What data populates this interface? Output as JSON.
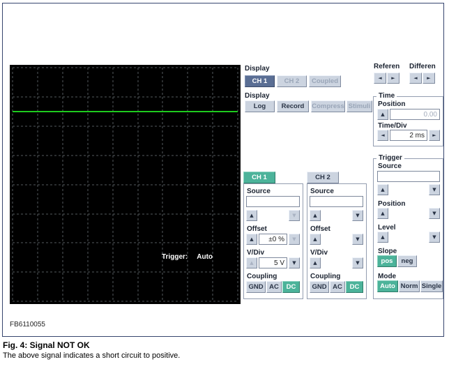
{
  "icons": {
    "up": "▲",
    "down": "▼",
    "left": "◄",
    "right": "►"
  },
  "colors": {
    "accent_teal": "#4cb39a",
    "active_blue": "#5a6e94",
    "scope_trace_green": "#1ecb1e"
  },
  "scope": {
    "trigger_label": "Trigger:",
    "trigger_value": "Auto"
  },
  "display_channels": {
    "label": "Display",
    "ch1": "CH 1",
    "ch2": "CH 2",
    "coupled": "Coupled"
  },
  "display_modes": {
    "label": "Display",
    "log": "Log",
    "record": "Record",
    "compress": "Compress",
    "stimuli": "Stimuli"
  },
  "reference": {
    "label": "Referen"
  },
  "difference": {
    "label": "Differen"
  },
  "time": {
    "label": "Time",
    "position_label": "Position",
    "position_value": "0.00",
    "timediv_label": "Time/Div",
    "timediv_value": "2 ms"
  },
  "trigger": {
    "label": "Trigger",
    "source_label": "Source",
    "position_label": "Position",
    "level_label": "Level",
    "slope_label": "Slope",
    "slope_pos": "pos",
    "slope_neg": "neg",
    "mode_label": "Mode",
    "mode_auto": "Auto",
    "mode_norm": "Norm",
    "mode_single": "Single"
  },
  "ch1": {
    "title": "CH 1",
    "source_label": "Source",
    "offset_label": "Offset",
    "offset_value": "±0 %",
    "vdiv_label": "V/Div",
    "vdiv_value": "5 V",
    "coupling_label": "Coupling",
    "gnd": "GND",
    "ac": "AC",
    "dc": "DC"
  },
  "ch2": {
    "title": "CH 2",
    "source_label": "Source",
    "offset_label": "Offset",
    "vdiv_label": "V/Div",
    "coupling_label": "Coupling",
    "gnd": "GND",
    "ac": "AC",
    "dc": "DC"
  },
  "figure": {
    "code": "FB6110055",
    "caption_title": "Fig. 4: Signal NOT OK",
    "caption_text": "The above signal indicates a short circuit to positive."
  }
}
